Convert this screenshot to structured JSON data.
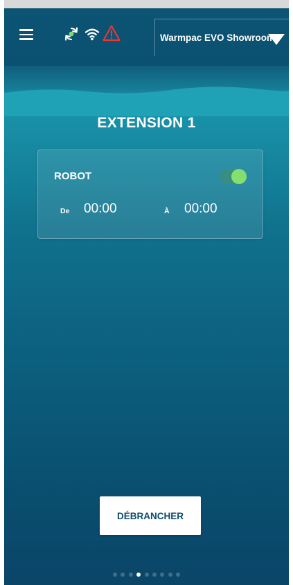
{
  "header": {
    "site_name": "Warmpac EVO Showroom",
    "icons": [
      "menu-icon",
      "sync-icon",
      "wifi-icon",
      "warning-icon"
    ],
    "warning_color": "#e53935",
    "sync_color": "#7ee06a"
  },
  "page": {
    "title": "EXTENSION 1"
  },
  "extension": {
    "name": "ROBOT",
    "enabled": true,
    "from_label": "De",
    "from_time": "00:00",
    "to_label": "À",
    "to_time": "00:00"
  },
  "actions": {
    "unplug_label": "DÉBRANCHER"
  },
  "pager": {
    "total": 9,
    "active_index": 3
  },
  "colors": {
    "toggle_on": "#84e06e",
    "button_text": "#0b4a6b"
  }
}
